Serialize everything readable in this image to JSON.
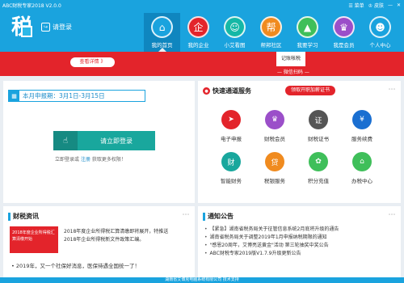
{
  "window": {
    "title": "ABC财税专家2018  V2.0.0",
    "menu_label": "菜单",
    "skin_label": "皮肤"
  },
  "header": {
    "logo_text": "税",
    "login_label": "请登录"
  },
  "nav": {
    "items": [
      {
        "label": "我的首页",
        "icon": "home-icon",
        "color": "#1aa3de",
        "glyph": "⌂"
      },
      {
        "label": "我的企业",
        "icon": "company-icon",
        "color": "#e3242b",
        "glyph": "企"
      },
      {
        "label": "小艾看图",
        "icon": "user-icon",
        "color": "#15b8a6",
        "glyph": "☺"
      },
      {
        "label": "帮邦社区",
        "icon": "community-icon",
        "color": "#f08b1f",
        "glyph": "帮"
      },
      {
        "label": "我要学习",
        "icon": "study-icon",
        "color": "#3fbf5a",
        "glyph": "▲"
      },
      {
        "label": "我是会员",
        "icon": "crown-icon",
        "color": "#9b4fc9",
        "glyph": "♛"
      },
      {
        "label": "个人中心",
        "icon": "person-icon",
        "color": "#1aa3de",
        "glyph": "☻"
      }
    ]
  },
  "banner": {
    "button_label": "查看详情 》",
    "code_label": "记账帐税",
    "code_caption": "— 微信扫码 —",
    "color": "#e3242b"
  },
  "period": {
    "icon": "calendar-icon",
    "text": "本月申报期：3月1日-3月15日"
  },
  "login_box": {
    "button_label": "请立即登录",
    "hint_prefix": "立即登录或",
    "hint_register": "注册",
    "hint_suffix": "获取更多权限！"
  },
  "services": {
    "title": "快速通道服务",
    "cert_button": "领取开职加薪证书",
    "items": [
      {
        "label": "电子申报",
        "icon": "paper-plane-icon",
        "color": "#e3242b",
        "glyph": "➤"
      },
      {
        "label": "财税会员",
        "icon": "member-icon",
        "color": "#9b4fc9",
        "glyph": "♛"
      },
      {
        "label": "财税证书",
        "icon": "certificate-icon",
        "color": "#555555",
        "glyph": "证"
      },
      {
        "label": "服务续费",
        "icon": "renew-icon",
        "color": "#1a6fd1",
        "glyph": "¥"
      },
      {
        "label": "智能财务",
        "icon": "finance-icon",
        "color": "#19a79d",
        "glyph": "财"
      },
      {
        "label": "税银服务",
        "icon": "loan-icon",
        "color": "#f08b1f",
        "glyph": "贷"
      },
      {
        "label": "积分充值",
        "icon": "points-icon",
        "color": "#3fbf5a",
        "glyph": "✿"
      },
      {
        "label": "办税中心",
        "icon": "tax-center-icon",
        "color": "#3fbf5a",
        "glyph": "⌂"
      }
    ]
  },
  "news": {
    "title": "财税资讯",
    "image_text": "2018年度企业所得税汇算清缴开始",
    "lines": [
      "2018年度企业所得税汇算清缴即将展开，特推送",
      "2018年企业所得税新文件政策汇编。"
    ],
    "footer": "2019年，又一个社保好消息，医保待遇全国统一了！"
  },
  "notices": {
    "title": "通知公告",
    "items": [
      "【紧急】湖南省税务局关于征管信息系统2月底将升级的通告",
      "湖南省税务局关于调整2019年1月申报纳税期限的通知",
      "\"感恩20周年，艾博亮送黄金\"活动 第三轮抽奖中奖公告",
      "ABC财税专家2019版V1.7.9升级更新公告"
    ]
  },
  "footer": {
    "text": "湖南省艾博克电脑系统有限公司  技术支持"
  }
}
